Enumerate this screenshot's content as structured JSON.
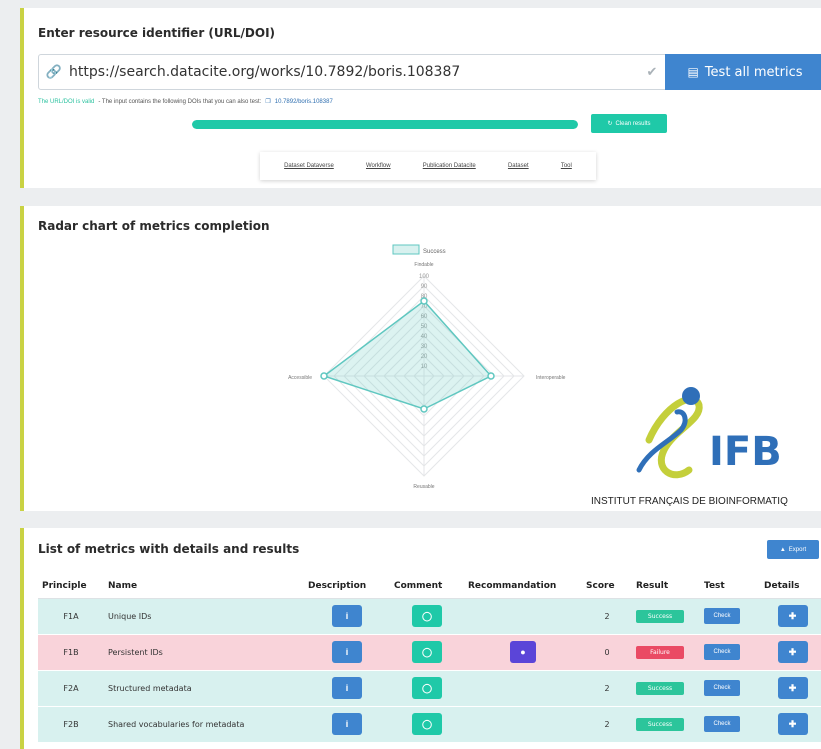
{
  "resource": {
    "title": "Enter resource identifier (URL/DOI)",
    "url_value": "https://search.datacite.org/works/10.7892/boris.108387",
    "test_button_label": "Test all metrics",
    "valid_text": "The URL/DOI is valid",
    "dois_text": "- The input contains the following DOIs that you can also test:",
    "doi_link": "10.7892/boris.108387",
    "progress_percent": 100,
    "clean_button_label": "Clean results",
    "examples": [
      "Dataset Dataverse",
      "Workflow",
      "Publication Datacite",
      "Dataset",
      "Tool"
    ]
  },
  "radar": {
    "title": "Radar chart of metrics completion",
    "legend_label": "Success",
    "ticks": [
      "100",
      "90",
      "80",
      "70",
      "60",
      "50",
      "40",
      "30",
      "20",
      "10"
    ],
    "logo": {
      "name": "ifb-logo",
      "text": "IFB",
      "subtitle": "INSTITUT FRANÇAIS DE BIOINFORMATIQ"
    }
  },
  "chart_data": {
    "type": "radar",
    "axes": [
      "Findable",
      "Interoperable",
      "Reusable",
      "Accessible"
    ],
    "series": [
      {
        "name": "Success",
        "values": [
          75,
          67,
          33,
          100
        ]
      }
    ],
    "rlim": [
      0,
      100
    ],
    "legend_position": "top",
    "color": "#5fc7c0"
  },
  "metrics": {
    "title": "List of metrics with details and results",
    "export_label": "Export",
    "headers": [
      "Principle",
      "Name",
      "Description",
      "Comment",
      "Recommandation",
      "Score",
      "Result",
      "Test",
      "Details"
    ],
    "check_label": "Check",
    "rows": [
      {
        "principle": "F1A",
        "name": "Unique IDs",
        "score": "2",
        "result": "Success",
        "status": "success",
        "recommendation": false
      },
      {
        "principle": "F1B",
        "name": "Persistent IDs",
        "score": "0",
        "result": "Failure",
        "status": "failure",
        "recommendation": true
      },
      {
        "principle": "F2A",
        "name": "Structured metadata",
        "score": "2",
        "result": "Success",
        "status": "success",
        "recommendation": false
      },
      {
        "principle": "F2B",
        "name": "Shared vocabularies for metadata",
        "score": "2",
        "result": "Success",
        "status": "success",
        "recommendation": false
      }
    ]
  },
  "colors": {
    "accent_border": "#c9d243",
    "primary_blue": "#3f85cf",
    "teal": "#1fc9a8",
    "success_row": "#d8f1ef",
    "failure_row": "#f9d3da"
  }
}
